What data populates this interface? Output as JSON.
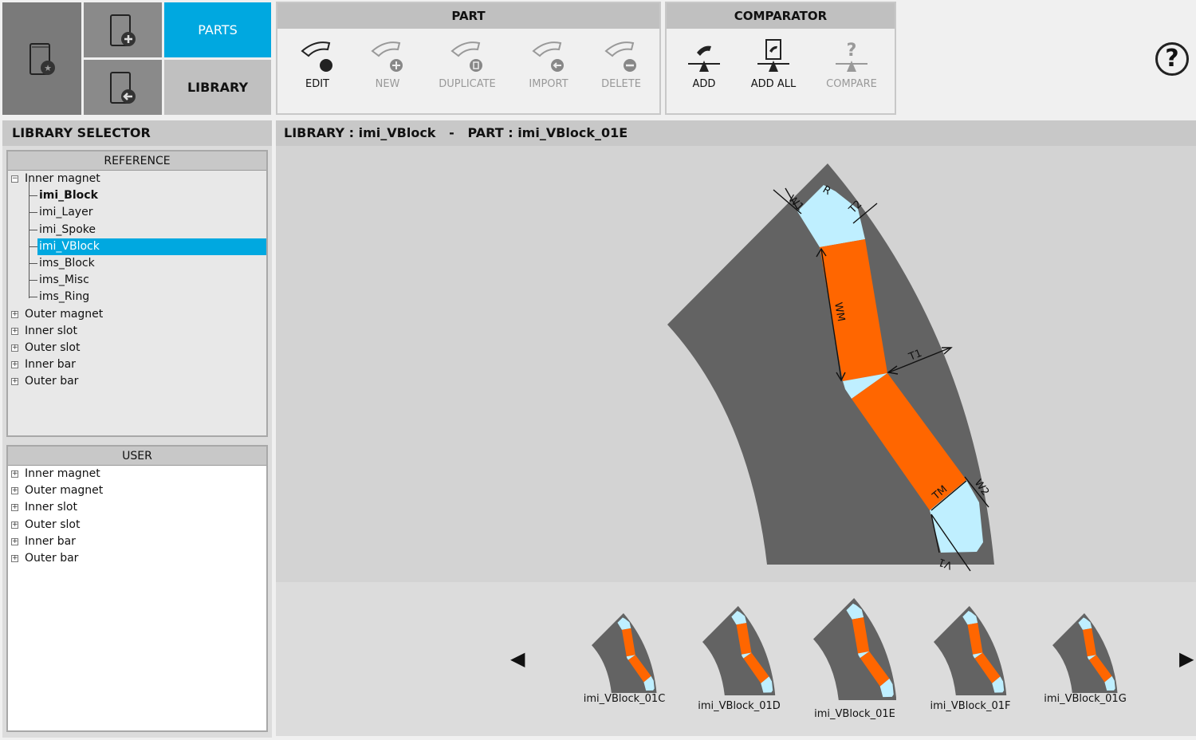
{
  "nav": {
    "parts_label": "PARTS",
    "library_label": "LIBRARY"
  },
  "part_group": {
    "title": "PART",
    "buttons": [
      {
        "label": "EDIT",
        "enabled": true
      },
      {
        "label": "NEW",
        "enabled": false
      },
      {
        "label": "DUPLICATE",
        "enabled": false
      },
      {
        "label": "IMPORT",
        "enabled": false
      },
      {
        "label": "DELETE",
        "enabled": false
      }
    ]
  },
  "comparator_group": {
    "title": "COMPARATOR",
    "buttons": [
      {
        "label": "ADD",
        "enabled": true
      },
      {
        "label": "ADD ALL",
        "enabled": true
      },
      {
        "label": "COMPARE",
        "enabled": false
      }
    ]
  },
  "help_label": "?",
  "library_selector": {
    "title": "LIBRARY SELECTOR",
    "reference": {
      "title": "REFERENCE",
      "items": [
        {
          "label": "Inner magnet",
          "expanded": true
        },
        {
          "label": "imi_Block"
        },
        {
          "label": "imi_Layer"
        },
        {
          "label": "imi_Spoke"
        },
        {
          "label": "imi_VBlock",
          "selected": true
        },
        {
          "label": "ims_Block"
        },
        {
          "label": "ims_Misc"
        },
        {
          "label": "ims_Ring"
        },
        {
          "label": "Outer magnet"
        },
        {
          "label": "Inner slot"
        },
        {
          "label": "Outer slot"
        },
        {
          "label": "Inner bar"
        },
        {
          "label": "Outer bar"
        }
      ]
    },
    "user": {
      "title": "USER",
      "items": [
        {
          "label": "Inner magnet"
        },
        {
          "label": "Outer magnet"
        },
        {
          "label": "Inner slot"
        },
        {
          "label": "Outer slot"
        },
        {
          "label": "Inner bar"
        },
        {
          "label": "Outer bar"
        }
      ]
    }
  },
  "viewer": {
    "header": "LIBRARY : imi_VBlock   -   PART : imi_VBlock_01E",
    "dimensions": {
      "w1": "W1",
      "r": "R",
      "t2": "T2",
      "wm": "WM",
      "t1": "T1",
      "tm": "TM",
      "w2": "W2",
      "v1": "V1"
    },
    "colors": {
      "steel": "#636363",
      "magnet": "#ff6600",
      "air": "#bfefff"
    }
  },
  "carousel": {
    "prev": "◀",
    "next": "▶",
    "items": [
      "imi_VBlock_01C",
      "imi_VBlock_01D",
      "imi_VBlock_01E",
      "imi_VBlock_01F",
      "imi_VBlock_01G"
    ]
  }
}
